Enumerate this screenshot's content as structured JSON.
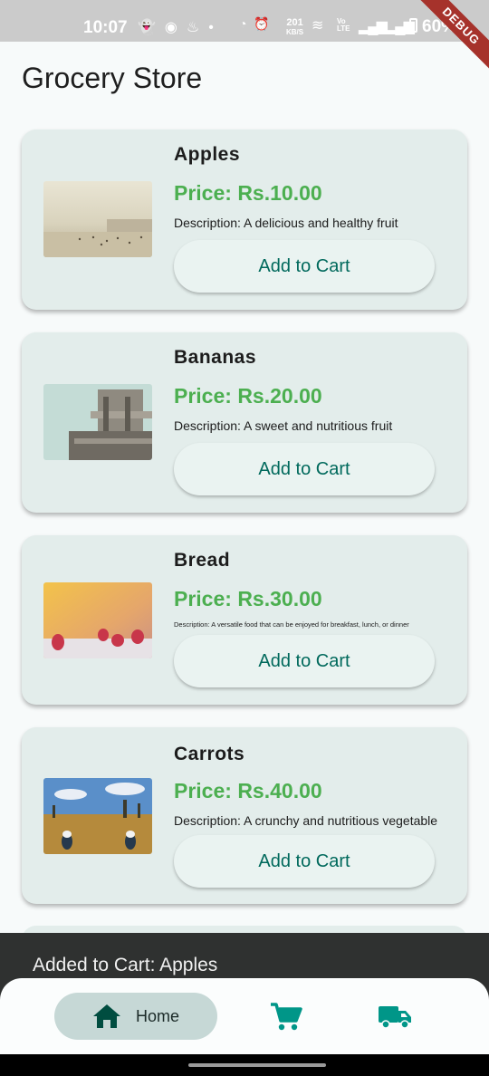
{
  "status_bar": {
    "time": "10:07",
    "net_speed_value": "201",
    "net_speed_unit": "KB/S",
    "battery": "60%",
    "debug_label": "DEBUG"
  },
  "app": {
    "title": "Grocery Store"
  },
  "products": [
    {
      "name": "Apples",
      "price": "Price: Rs.10.00",
      "description": "Description: A delicious and healthy fruit",
      "button": "Add to Cart"
    },
    {
      "name": "Bananas",
      "price": "Price: Rs.20.00",
      "description": "Description: A sweet and nutritious fruit",
      "button": "Add to Cart"
    },
    {
      "name": "Bread",
      "price": "Price: Rs.30.00",
      "description": "Description: A versatile food that can be enjoyed for breakfast, lunch, or dinner",
      "button": "Add to Cart"
    },
    {
      "name": "Carrots",
      "price": "Price: Rs.40.00",
      "description": "Description: A crunchy and nutritious vegetable",
      "button": "Add to Cart"
    }
  ],
  "snackbar": {
    "message": "Added to Cart: Apples"
  },
  "bottom_nav": {
    "items": [
      {
        "label": "Home",
        "icon": "home-icon",
        "selected": true
      },
      {
        "label": "",
        "icon": "cart-icon",
        "selected": false
      },
      {
        "label": "",
        "icon": "truck-icon",
        "selected": false
      }
    ]
  },
  "colors": {
    "price_green": "#4caf50",
    "button_text_teal": "#00695c",
    "card_bg": "#e3edeb",
    "nav_icon_teal": "#009688"
  }
}
